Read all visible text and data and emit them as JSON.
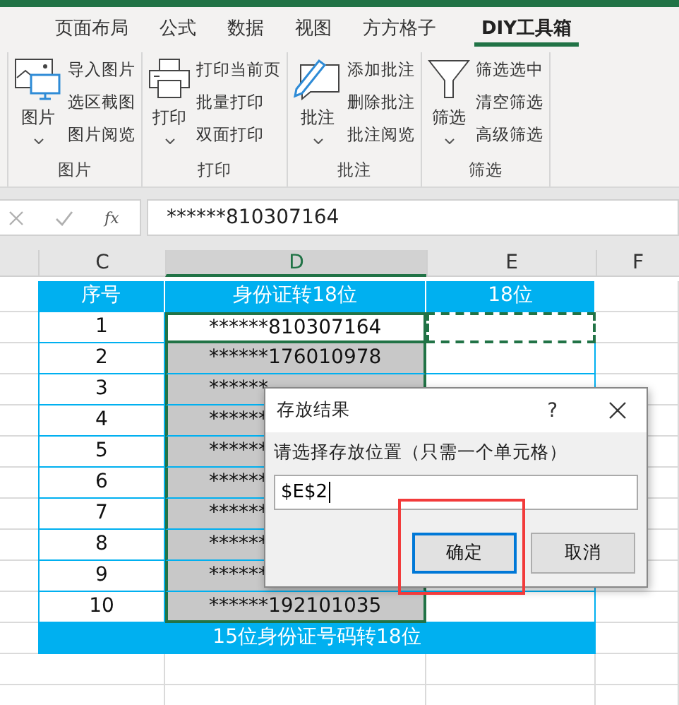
{
  "ribbon": {
    "tabs": [
      {
        "label": "页面布局",
        "selected": false
      },
      {
        "label": "公式",
        "selected": false
      },
      {
        "label": "数据",
        "selected": false
      },
      {
        "label": "视图",
        "selected": false
      },
      {
        "label": "方方格子",
        "selected": false
      },
      {
        "label": "DIY工具箱",
        "selected": true
      }
    ],
    "groups": [
      {
        "label": "图片",
        "main": {
          "label": "图片",
          "kind": "picture"
        },
        "items": [
          "导入图片",
          "选区截图",
          "图片阅览"
        ]
      },
      {
        "label": "打印",
        "main": {
          "label": "打印",
          "kind": "printer"
        },
        "items": [
          "打印当前页",
          "批量打印",
          "双面打印"
        ]
      },
      {
        "label": "批注",
        "main": {
          "label": "批注",
          "kind": "comment"
        },
        "items": [
          "添加批注",
          "删除批注",
          "批注阅览"
        ]
      },
      {
        "label": "筛选",
        "main": {
          "label": "筛选",
          "kind": "funnel"
        },
        "items": [
          "筛选选中",
          "清空筛选",
          "高级筛选"
        ]
      }
    ]
  },
  "formula_bar": {
    "function_label": "fx",
    "value": "******810307164"
  },
  "sheet": {
    "columns": [
      {
        "label": "C",
        "selected": false
      },
      {
        "label": "D",
        "selected": true
      },
      {
        "label": "E",
        "selected": false
      },
      {
        "label": "F",
        "selected": false
      }
    ],
    "header": [
      "序号",
      "身份证转18位",
      "18位"
    ],
    "rows": [
      {
        "number": "1",
        "id": "******810307164",
        "active": true
      },
      {
        "number": "2",
        "id": "******176010978",
        "active": false
      },
      {
        "number": "3",
        "id": "******",
        "active": false
      },
      {
        "number": "4",
        "id": "******",
        "active": false
      },
      {
        "number": "5",
        "id": "******",
        "active": false
      },
      {
        "number": "6",
        "id": "******",
        "active": false
      },
      {
        "number": "7",
        "id": "******",
        "active": false
      },
      {
        "number": "8",
        "id": "******",
        "active": false
      },
      {
        "number": "9",
        "id": "******",
        "active": false
      },
      {
        "number": "10",
        "id": "******192101035",
        "active": false
      }
    ],
    "footer": "15位身份证号码转18位"
  },
  "dialog": {
    "title": "存放结果",
    "help": "?",
    "prompt": "请选择存放位置（只需一个单元格）",
    "value": "$E$2",
    "highlight": true,
    "buttons": [
      {
        "label": "确定",
        "default": true
      },
      {
        "label": "取消",
        "default": false
      }
    ]
  }
}
